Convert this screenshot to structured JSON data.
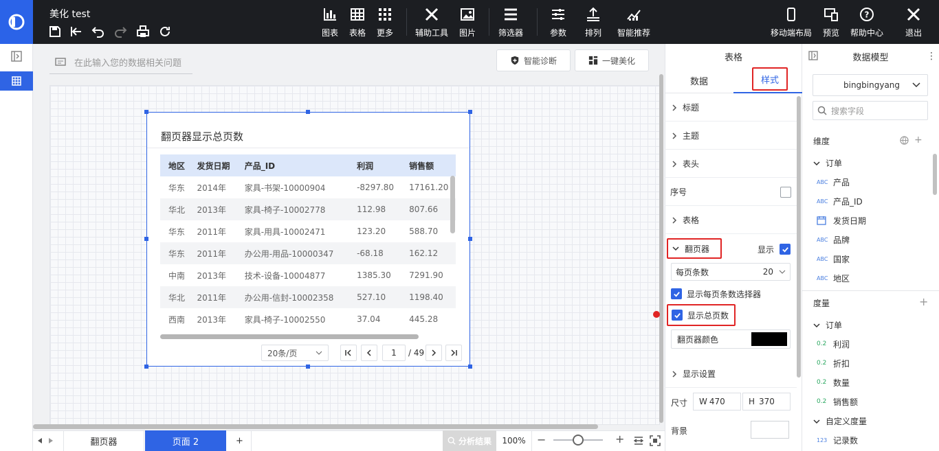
{
  "app": {
    "title": "美化 test"
  },
  "toolbar": {
    "chart": "图表",
    "table": "表格",
    "more": "更多",
    "aux_tools": "辅助工具",
    "image": "图片",
    "filter": "筛选器",
    "params": "参数",
    "arrange": "排列",
    "smart": "智能推荐",
    "mobile": "移动端布局",
    "preview": "预览",
    "help": "帮助中心",
    "exit": "退出"
  },
  "canvas": {
    "ask_placeholder": "在此输入您的数据相关问题",
    "diagnose": "智能诊断",
    "beautify": "一键美化"
  },
  "widget": {
    "title": "翻页器显示总页数",
    "columns": [
      "地区",
      "发货日期",
      "产品_ID",
      "利润",
      "销售额"
    ],
    "rows": [
      [
        "华东",
        "2014年",
        "家具-书架-10000904",
        "-8297.80",
        "17161.20"
      ],
      [
        "华北",
        "2013年",
        "家具-椅子-10002778",
        "112.98",
        "807.66"
      ],
      [
        "华东",
        "2011年",
        "家具-用具-10002471",
        "123.20",
        "588.70"
      ],
      [
        "华东",
        "2011年",
        "办公用-用品-10000347",
        "-68.18",
        "162.12"
      ],
      [
        "中南",
        "2013年",
        "技术-设备-10004877",
        "1385.30",
        "7291.90"
      ],
      [
        "华北",
        "2011年",
        "办公用-信封-10002358",
        "527.10",
        "1198.40"
      ],
      [
        "西南",
        "2013年",
        "家具-椅子-10002550",
        "37.04",
        "445.28"
      ]
    ],
    "pager": {
      "page_size": "20条/页",
      "current": "1",
      "total": "/ 49"
    }
  },
  "bottom": {
    "tabs": [
      "翻页器",
      "页面 2"
    ],
    "add": "+",
    "analysis": "分析结果",
    "zoom": "100%",
    "zoom_level_percent": 50
  },
  "style_panel": {
    "header": "表格",
    "tab_data": "数据",
    "tab_style": "样式",
    "sections": {
      "title": "标题",
      "theme": "主题",
      "header": "表头",
      "seq": "序号",
      "table": "表格"
    },
    "pager": {
      "label": "翻页器",
      "show": "显示",
      "per_page_label": "每页条数",
      "per_page_value": "20",
      "show_size_selector": "显示每页条数选择器",
      "show_total": "显示总页数",
      "color_label": "翻页器颜色",
      "color_value": "#000000"
    },
    "display": "显示设置",
    "size": {
      "label": "尺寸",
      "w_prefix": "W",
      "w": "470",
      "h_prefix": "H",
      "h": "370"
    },
    "background": "背景"
  },
  "model": {
    "header": "数据模型",
    "dataset": "bingbingyang",
    "search_placeholder": "搜索字段",
    "dimension": "维度",
    "measure": "度量",
    "dim_group": "订单",
    "dim_fields": [
      {
        "type": "ABC",
        "name": "产品"
      },
      {
        "type": "ABC",
        "name": "产品_ID"
      },
      {
        "type": "DATE",
        "name": "发货日期"
      },
      {
        "type": "ABC",
        "name": "品牌"
      },
      {
        "type": "ABC",
        "name": "国家"
      },
      {
        "type": "ABC",
        "name": "地区"
      }
    ],
    "measure_group": "订单",
    "measure_fields": [
      {
        "type": "0.2",
        "name": "利润"
      },
      {
        "type": "0.2",
        "name": "折扣"
      },
      {
        "type": "0.2",
        "name": "数量"
      },
      {
        "type": "0.2",
        "name": "销售额"
      }
    ],
    "custom_group": "自定义度量",
    "custom_fields": [
      {
        "type": "123",
        "name": "记录数"
      }
    ]
  },
  "colors": {
    "accent": "#2f64e4",
    "topbar": "#1c1e22",
    "highlight": "#e02424"
  }
}
